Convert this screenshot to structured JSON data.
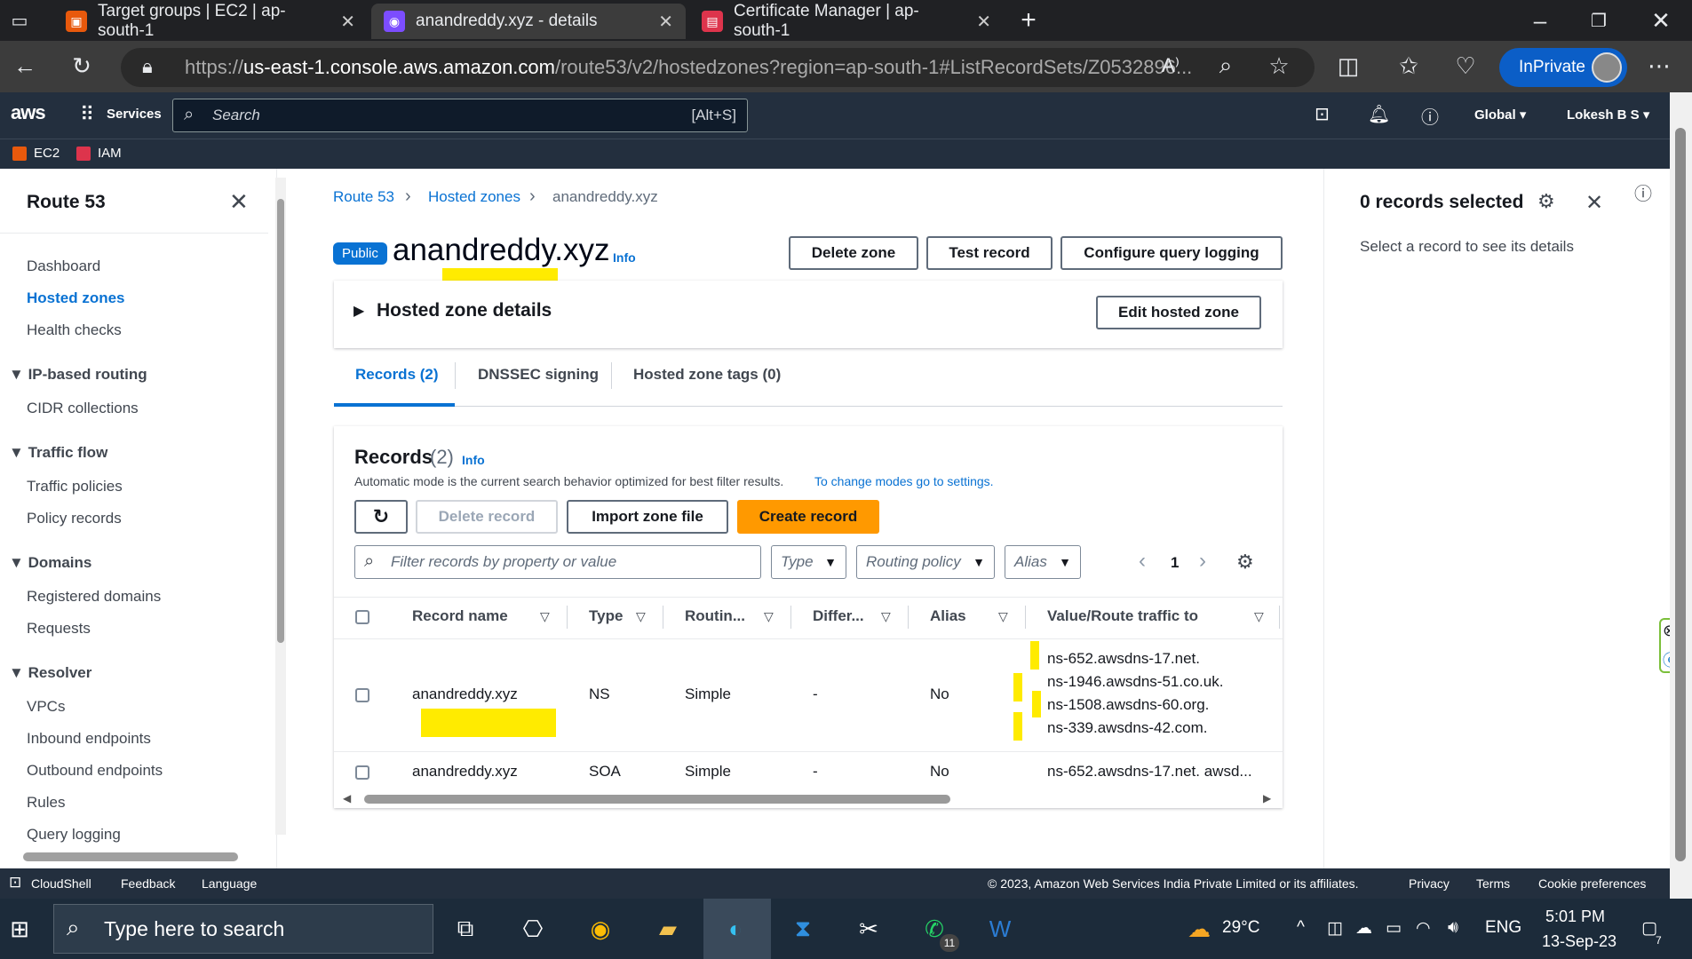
{
  "browser": {
    "tabs": [
      {
        "title": "Target groups | EC2 | ap-south-1",
        "color": "#e8590c"
      },
      {
        "title": "anandreddy.xyz - details",
        "color": "#7c4dff"
      },
      {
        "title": "Certificate Manager | ap-south-1",
        "color": "#dd344c"
      }
    ],
    "url_prefix": "https://",
    "url_host": "us-east-1.console.aws.amazon.com",
    "url_path": "/route53/v2/hostedzones?region=ap-south-1#ListRecordSets/Z0532896...",
    "inprivate_label": "InPrivate"
  },
  "aws_nav": {
    "logo": "aws",
    "services_label": "Services",
    "search_placeholder": "Search",
    "search_shortcut": "[Alt+S]",
    "region": "Global",
    "user": "Lokesh B S",
    "favorites": [
      {
        "label": "EC2",
        "color": "#e8590c"
      },
      {
        "label": "IAM",
        "color": "#dd344c"
      }
    ]
  },
  "sidebar": {
    "title": "Route 53",
    "dashboard": "Dashboard",
    "hosted_zones": "Hosted zones",
    "health_checks": "Health checks",
    "sec_ip": "IP-based routing",
    "cidr": "CIDR collections",
    "sec_traffic": "Traffic flow",
    "traffic_policies": "Traffic policies",
    "policy_records": "Policy records",
    "sec_domains": "Domains",
    "registered_domains": "Registered domains",
    "requests": "Requests",
    "sec_resolver": "Resolver",
    "vpcs": "VPCs",
    "inbound": "Inbound endpoints",
    "outbound": "Outbound endpoints",
    "rules": "Rules",
    "query_logging": "Query logging"
  },
  "breadcrumb": {
    "root": "Route 53",
    "parent": "Hosted zones",
    "current": "anandreddy.xyz"
  },
  "zone": {
    "badge": "Public",
    "name": "anandreddy.xyz",
    "info": "Info",
    "delete_zone": "Delete zone",
    "test_record": "Test record",
    "configure_logging": "Configure query logging",
    "details_label": "Hosted zone details",
    "edit_zone": "Edit hosted zone"
  },
  "tabs": {
    "records": "Records (2)",
    "dnssec": "DNSSEC signing",
    "tags": "Hosted zone tags (0)"
  },
  "records": {
    "heading": "Records",
    "count": "(2)",
    "info": "Info",
    "mode_text": "Automatic mode is the current search behavior optimized for best filter results.",
    "mode_link": "To change modes go to settings.",
    "delete_record": "Delete record",
    "import_zone": "Import zone file",
    "create_record": "Create record",
    "filter_placeholder": "Filter records by property or value",
    "filter_type": "Type",
    "filter_routing": "Routing policy",
    "filter_alias": "Alias",
    "page": "1",
    "columns": [
      "Record name",
      "Type",
      "Routin...",
      "Differ...",
      "Alias",
      "Value/Route traffic to"
    ],
    "rows": [
      {
        "name": "anandreddy.xyz",
        "type": "NS",
        "routing": "Simple",
        "differ": "-",
        "alias": "No",
        "values": [
          "ns-652.awsdns-17.net.",
          "ns-1946.awsdns-51.co.uk.",
          "ns-1508.awsdns-60.org.",
          "ns-339.awsdns-42.com."
        ]
      },
      {
        "name": "anandreddy.xyz",
        "type": "SOA",
        "routing": "Simple",
        "differ": "-",
        "alias": "No",
        "value": "ns-652.awsdns-17.net. awsd..."
      }
    ]
  },
  "right_panel": {
    "title": "0 records selected",
    "subtitle": "Select a record to see its details"
  },
  "footer": {
    "cloudshell": "CloudShell",
    "feedback": "Feedback",
    "language": "Language",
    "copyright": "© 2023, Amazon Web Services India Private Limited or its affiliates.",
    "privacy": "Privacy",
    "terms": "Terms",
    "cookies": "Cookie preferences"
  },
  "taskbar": {
    "search_placeholder": "Type here to search",
    "weather": "29°C",
    "lang": "ENG",
    "time": "5:01 PM",
    "date": "13-Sep-23",
    "whatsapp_badge": "11",
    "notif_badge": "7"
  },
  "colors": {
    "accent": "#0972d3",
    "primary_button": "#ff9900",
    "aws_nav": "#232f3e",
    "highlight": "#ffeb00"
  }
}
